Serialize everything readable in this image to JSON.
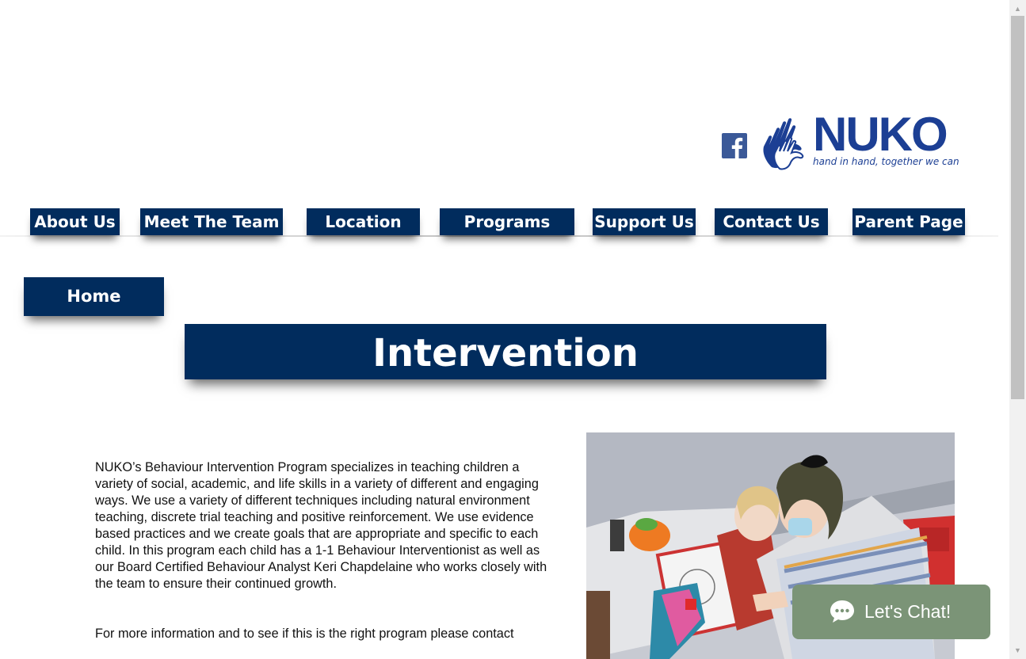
{
  "header": {
    "logo": {
      "name": "NUKO",
      "tagline": "hand in hand, together we can"
    },
    "social": {
      "facebook_icon": "facebook-icon"
    }
  },
  "nav": {
    "items": [
      {
        "label": "About Us"
      },
      {
        "label": "Meet The Team"
      },
      {
        "label": "Location"
      },
      {
        "label": "Programs"
      },
      {
        "label": "Support Us"
      },
      {
        "label": "Contact Us"
      },
      {
        "label": "Parent Page"
      }
    ],
    "home_label": "Home"
  },
  "main": {
    "title": "Intervention",
    "paragraphs": [
      "NUKO’s Behaviour Intervention Program specializes in teaching children a variety of social, academic, and life skills in a variety of different and engaging ways. We use a variety of different techniques including natural environment teaching, discrete trial teaching and positive reinforcement. We use evidence based practices and we create goals that are appropriate and specific to each child. In this program each child has a 1-1 Behaviour Interventionist as well as our Board Certified Behaviour Analyst Keri Chapdelaine who works closely with the team to ensure their continued growth.",
      "For more information and to see if this is the right program please contact"
    ]
  },
  "chat": {
    "label": "Let's Chat!",
    "icon": "chat-bubble-icon"
  },
  "colors": {
    "navy": "#012c5d",
    "logo_blue": "#1c3f94",
    "chat_green": "#7b9477",
    "facebook": "#3b5998"
  }
}
